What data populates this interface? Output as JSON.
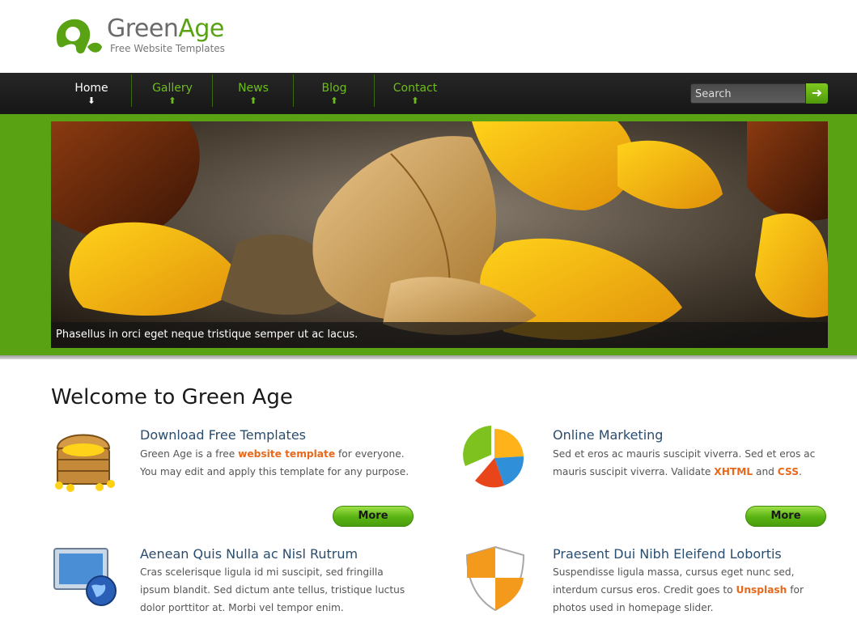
{
  "brand": {
    "name_part1": "Green",
    "name_part2": "Age",
    "tagline": "Free Website Templates",
    "colors": {
      "green": "#58a214",
      "dark": "#1f1f1f",
      "accent_orange": "#e8691b",
      "link_blue": "#2a4d6e"
    }
  },
  "nav": {
    "items": [
      {
        "label": "Home",
        "arrow": "⬇"
      },
      {
        "label": "Gallery",
        "arrow": "⬆"
      },
      {
        "label": "News",
        "arrow": "⬆"
      },
      {
        "label": "Blog",
        "arrow": "⬆"
      },
      {
        "label": "Contact",
        "arrow": "⬆"
      }
    ],
    "search": {
      "placeholder": "Search",
      "button_icon": "arrow-right-icon",
      "button_glyph": "➜"
    }
  },
  "slider": {
    "caption": "Phasellus in orci eget neque tristique semper ut ac lacus."
  },
  "content": {
    "heading": "Welcome to Green Age",
    "features": [
      {
        "icon": "treasure-chest-icon",
        "title": "Download Free Templates",
        "text_a": "Green Age is a free ",
        "link1": "website template",
        "text_b": " for everyone. You may edit and apply this template for any purpose.",
        "more": "More"
      },
      {
        "icon": "pie-chart-icon",
        "title": "Online Marketing",
        "text_a": "Sed et eros ac mauris suscipit viverra. Sed et eros ac mauris suscipit viverra. Validate ",
        "link1": "XHTML",
        "text_b": " and ",
        "link2": "CSS",
        "text_c": ".",
        "more": "More"
      },
      {
        "icon": "monitor-globe-icon",
        "title": "Aenean Quis Nulla ac Nisl Rutrum",
        "text_a": "Cras scelerisque ligula id mi suscipit, sed fringilla ipsum blandit. Sed dictum ante tellus, tristique luctus dolor porttitor at. Morbi vel tempor enim."
      },
      {
        "icon": "shield-icon",
        "title": "Praesent Dui Nibh Eleifend Lobortis",
        "text_a": "Suspendisse ligula massa, cursus eget nunc sed, interdum cursus eros. Credit goes to ",
        "link1": "Unsplash",
        "text_b": " for photos used in homepage slider."
      }
    ]
  }
}
